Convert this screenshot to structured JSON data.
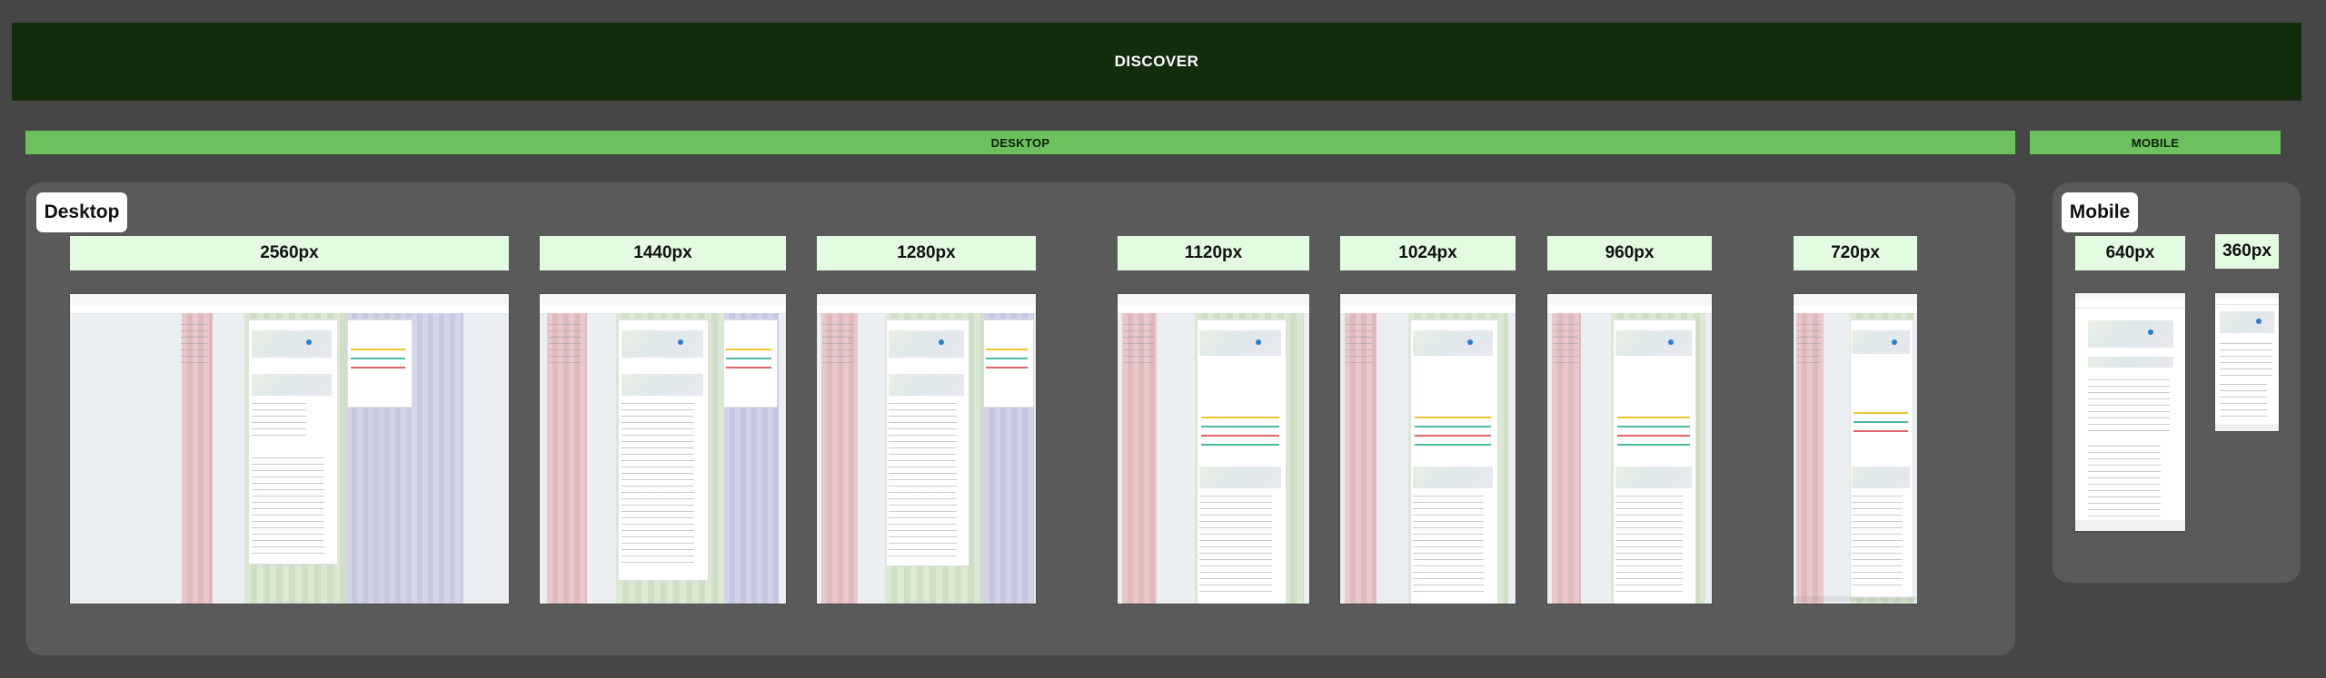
{
  "title": "DISCOVER",
  "sections": {
    "desktop": "DESKTOP",
    "mobile": "MOBILE"
  },
  "containers": {
    "desktop": "Desktop",
    "mobile": "Mobile"
  },
  "breakpoints": {
    "bp2560": "2560px",
    "bp1440": "1440px",
    "bp1280": "1280px",
    "bp1120": "1120px",
    "bp1024": "1024px",
    "bp960": "960px",
    "bp720": "720px",
    "bp640": "640px",
    "bp360": "360px"
  },
  "colors": {
    "background": "#464646",
    "banner": "#132c0e",
    "section_bar": "#6cc15e",
    "breakpoint_label": "#e2fbe1",
    "container": "#5a5a5a"
  }
}
